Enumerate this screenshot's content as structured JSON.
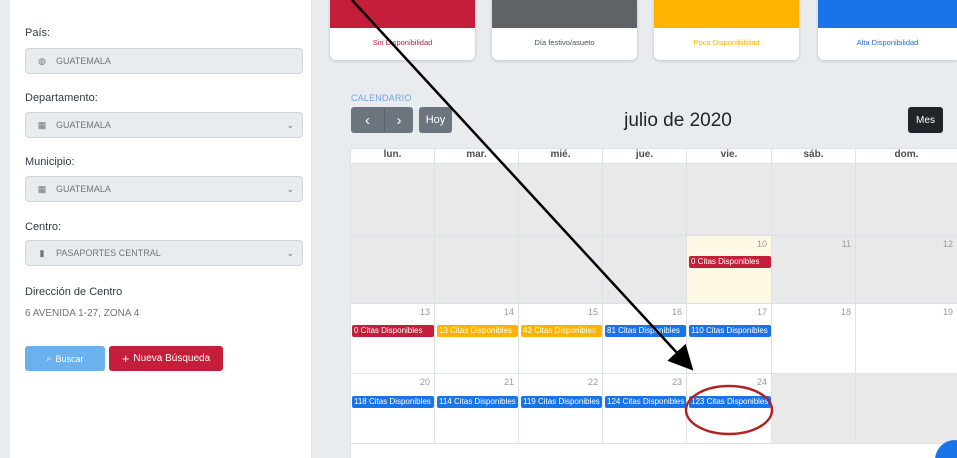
{
  "form": {
    "pais_label": "País:",
    "pais_value": "GUATEMALA",
    "departamento_label": "Departamento:",
    "departamento_value": "GUATEMALA",
    "municipio_label": "Municipio:",
    "municipio_value": "GUATEMALA",
    "centro_label": "Centro:",
    "centro_value": "PASAPORTES CENTRAL",
    "direccion_label": "Dirección de Centro",
    "direccion_value": "6 AVENIDA 1-27, ZONA 4",
    "buscar_label": "Buscar",
    "nueva_label": "Nueva Búsqueda"
  },
  "legend": [
    {
      "label": "Sin Disponibilidad",
      "color": "#c41e3a",
      "text_color": "#c41e3a"
    },
    {
      "label": "Día festivo/asueto",
      "color": "#5f6366",
      "text_color": "#495057"
    },
    {
      "label": "Poca Disponibilidad",
      "color": "#ffb300",
      "text_color": "#ffb300"
    },
    {
      "label": "Alta Disponibilidad",
      "color": "#1a73e8",
      "text_color": "#1a73e8"
    }
  ],
  "calendar": {
    "caption": "CALENDARIO",
    "prev": "‹",
    "next": "›",
    "today_label": "Hoy",
    "title": "julio de 2020",
    "view_label": "Mes",
    "weekdays": [
      "lun.",
      "mar.",
      "mié.",
      "jue.",
      "vie.",
      "sáb.",
      "dom."
    ],
    "day_numbers": {
      "d10": "10",
      "d11": "11",
      "d12": "12",
      "d13": "13",
      "d14": "14",
      "d15": "15",
      "d16": "16",
      "d17": "17",
      "d18": "18",
      "d19": "19",
      "d20": "20",
      "d21": "21",
      "d22": "22",
      "d23": "23",
      "d24": "24"
    },
    "events": {
      "e10": "0 Citas Disponibles",
      "e13": "0 Citas Disponibles",
      "e14": "13 Citas Disponibles",
      "e15": "43 Citas Disponibles",
      "e16": "81 Citas Disponibles",
      "e17": "110 Citas Disponibles",
      "e20": "118 Citas Disponibles",
      "e21": "114 Citas Disponibles",
      "e22": "119 Citas Disponibles",
      "e23": "124 Citas Disponibles",
      "e24": "123 Citas Disponibles"
    }
  },
  "colors": {
    "red": "#c41e3a",
    "orange": "#ffb300",
    "blue": "#1a73e8",
    "annotation": "#b22222"
  }
}
